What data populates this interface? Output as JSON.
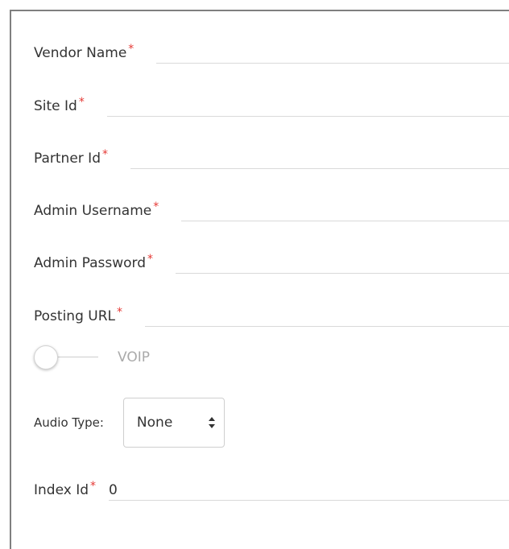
{
  "form": {
    "fields": [
      {
        "label": "Vendor Name",
        "required": "*",
        "value": ""
      },
      {
        "label": "Site Id",
        "required": "*",
        "value": ""
      },
      {
        "label": "Partner Id",
        "required": "*",
        "value": ""
      },
      {
        "label": "Admin Username",
        "required": "*",
        "value": ""
      },
      {
        "label": "Admin Password",
        "required": "*",
        "value": ""
      },
      {
        "label": "Posting URL",
        "required": "*",
        "value": ""
      }
    ],
    "voip": {
      "label": "VOIP",
      "enabled": false
    },
    "audio_type": {
      "label": "Audio Type:",
      "selected": "None",
      "options": [
        "None"
      ]
    },
    "index_id": {
      "label": "Index Id",
      "required": "*",
      "value": "0"
    }
  },
  "colors": {
    "required_star": "#e53935",
    "border": "#7f7f7f",
    "underline": "#d9d9d9",
    "muted_text": "#aaaaaa"
  },
  "icons": {
    "select_arrows": "updown-chevron-icon"
  }
}
